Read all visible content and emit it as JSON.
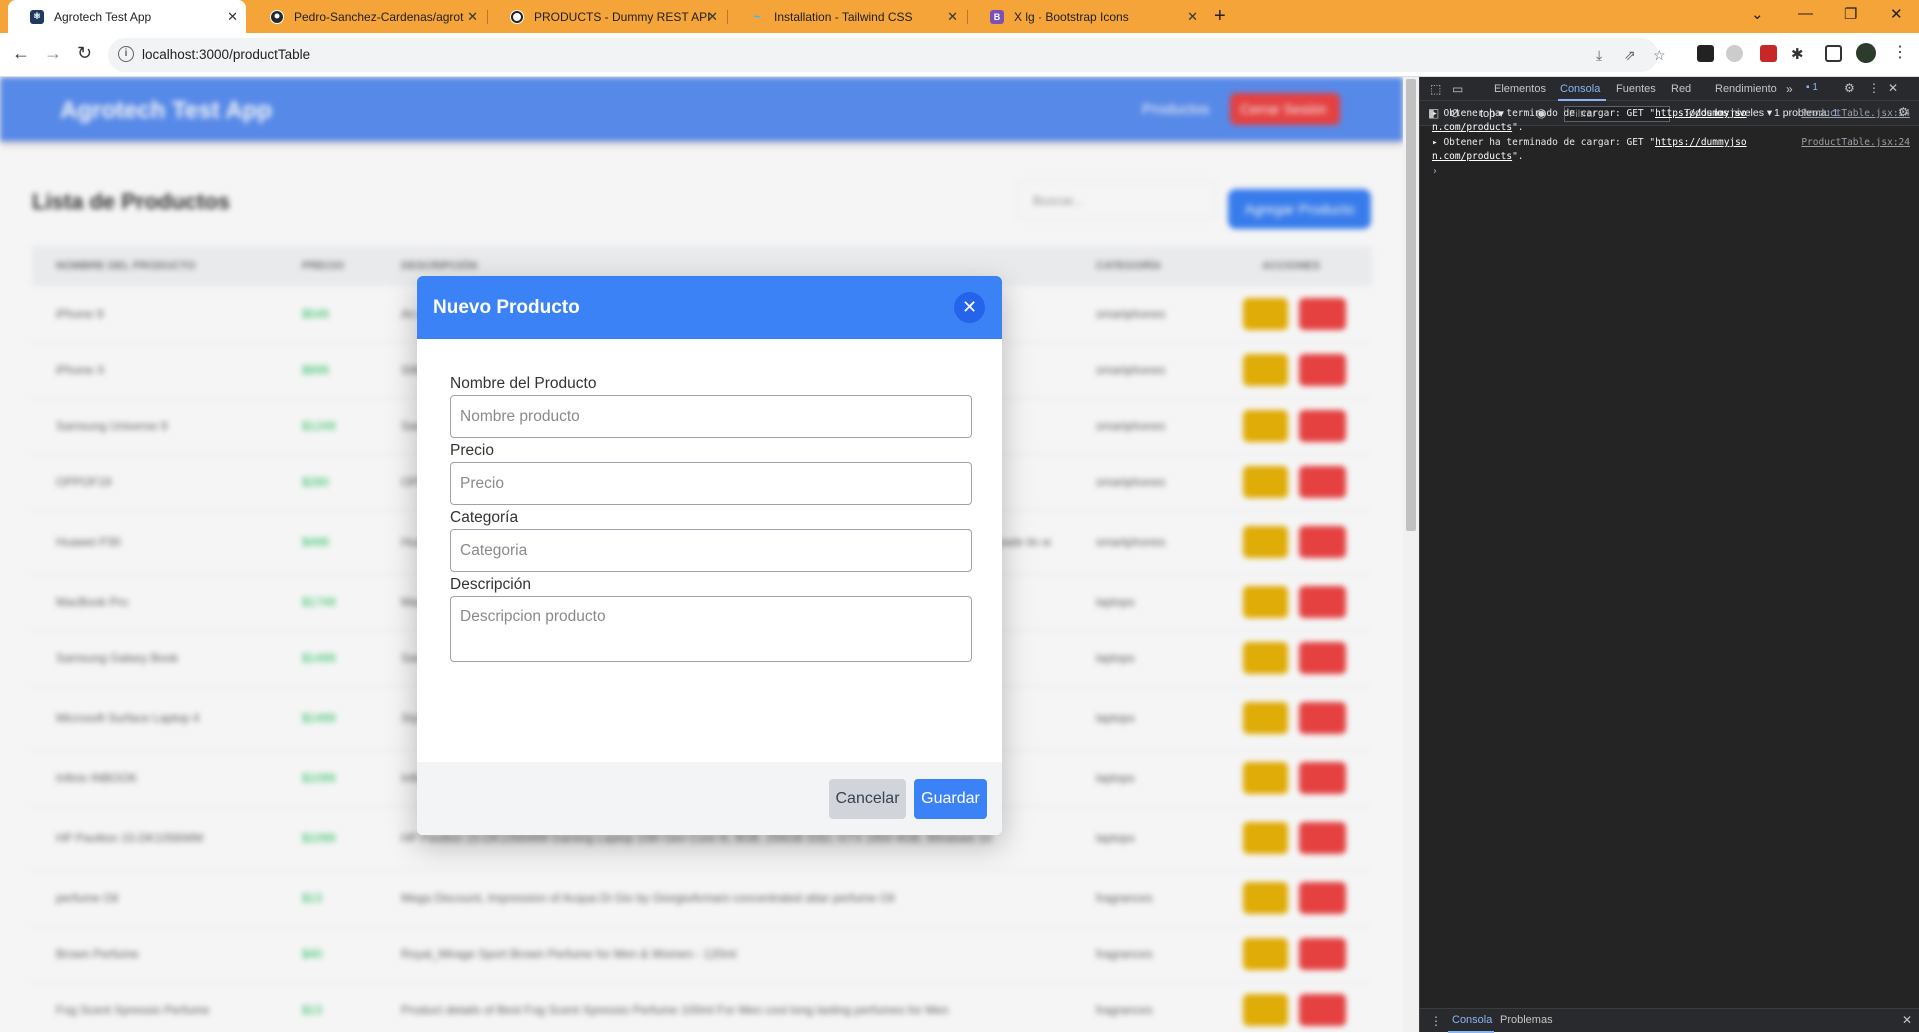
{
  "browser": {
    "tabs": [
      {
        "title": "Agrotech Test App",
        "favicon": "react-icon",
        "color": "#1e3a5f"
      },
      {
        "title": "Pedro-Sanchez-Cardenas/agrot",
        "favicon": "github-icon",
        "color": "#24292e"
      },
      {
        "title": "PRODUCTS - Dummy REST API c",
        "favicon": "dummyjson-icon",
        "color": "#222222"
      },
      {
        "title": "Installation - Tailwind CSS",
        "favicon": "tailwind-icon",
        "color": "#38bdf8"
      },
      {
        "title": "X lg · Bootstrap Icons",
        "favicon": "bootstrap-icon",
        "color": "#7952b3"
      }
    ],
    "url": "localhost:3000/productTable"
  },
  "app": {
    "brand": "Agrotech Test App",
    "nav_link": "Productos",
    "logout_label": "Cerrar Sesión",
    "page_title": "Lista de Productos",
    "search_placeholder": "Buscar...",
    "add_button": "Agregar Producto",
    "columns": [
      "NOMBRE DEL PRODUCTO",
      "PRECIO",
      "DESCRIPCIÓN",
      "CATEGORÍA",
      "ACCIONES"
    ],
    "rows": [
      {
        "name": "iPhone 9",
        "price": "$549",
        "desc": "An apple mobile which is nothing like apple",
        "cat": "smartphones"
      },
      {
        "name": "iPhone X",
        "price": "$899",
        "desc": "SIM-Free, Model A19211 6.5-inch Super Retina HD display with OLED technology A12 Bionic chip with ...",
        "cat": "smartphones"
      },
      {
        "name": "Samsung Universe 9",
        "price": "$1249",
        "desc": "Samsung's new variant which goes beyond Galaxy to the Universe",
        "cat": "smartphones"
      },
      {
        "name": "OPPOF19",
        "price": "$280",
        "desc": "OPPO F19 is officially announced on April 2021.",
        "cat": "smartphones"
      },
      {
        "name": "Huawei P30",
        "price": "$499",
        "desc": "Huawei's re-badged P30 Pro New Edition was officially unveiled yesterday in Germany and now the device has made its way to the UK.",
        "cat": "smartphones"
      },
      {
        "name": "MacBook Pro",
        "price": "$1749",
        "desc": "MacBook Pro 2021 with mini-LED display may launch between September, November",
        "cat": "laptops"
      },
      {
        "name": "Samsung Galaxy Book",
        "price": "$1499",
        "desc": "Samsung Galaxy Book S (2020) Laptop With Intel Lakefield Chip, 8GB of RAM Launched",
        "cat": "laptops"
      },
      {
        "name": "Microsoft Surface Laptop 4",
        "price": "$1499",
        "desc": "Style and speed. Stand out on HD video calls backed by Studio Mics. Capture ideas on the vibrant touchscreen.",
        "cat": "laptops"
      },
      {
        "name": "Infinix INBOOK",
        "price": "$1099",
        "desc": "Infinix Inbook X1 Ci3 10th 8GB 256GB 14 Win10 Grey – 1 Year Warranty",
        "cat": "laptops"
      },
      {
        "name": "HP Pavilion 15-DK1056WM",
        "price": "$1099",
        "desc": "HP Pavilion 15-DK1056WM Gaming Laptop 10th Gen Core i5, 8GB, 256GB SSD, GTX 1650 4GB, Windows 10",
        "cat": "laptops"
      },
      {
        "name": "perfume Oil",
        "price": "$13",
        "desc": "Mega Discount, Impression of Acqua Di Gio by GiorgioArmani concentrated attar perfume Oil",
        "cat": "fragrances"
      },
      {
        "name": "Brown Perfume",
        "price": "$40",
        "desc": "Royal_Mirage Sport Brown Perfume for Men & Women - 120ml",
        "cat": "fragrances"
      },
      {
        "name": "Fog Scent Xpressio Perfume",
        "price": "$13",
        "desc": "Product details of Best Fog Scent Xpressio Perfume 100ml For Men cool long lasting perfumes for Men",
        "cat": "fragrances"
      }
    ]
  },
  "modal": {
    "title": "Nuevo Producto",
    "fields": [
      {
        "label": "Nombre del Producto",
        "placeholder": "Nombre producto"
      },
      {
        "label": "Precio",
        "placeholder": "Precio"
      },
      {
        "label": "Categoría",
        "placeholder": "Categoria"
      },
      {
        "label": "Descripción",
        "placeholder": "Descripcion producto"
      }
    ],
    "cancel": "Cancelar",
    "save": "Guardar"
  },
  "devtools": {
    "tabs": [
      "Elementos",
      "Consola",
      "Fuentes",
      "Red",
      "Rendimiento"
    ],
    "issues_badge": "1",
    "context": "top",
    "filter_placeholder": "Filtrar",
    "levels": "Todos los niveles",
    "problems": "1 problema:",
    "problems_count": "1",
    "logs": [
      {
        "prefix": "Obtener ha terminado de cargar: GET \"",
        "link1": "https://dummyjso",
        "link2": "n.com/products",
        "suffix": "\".",
        "source": "ProductTable.jsx:24"
      },
      {
        "prefix": "Obtener ha terminado de cargar: GET \"",
        "link1": "https://dummyjso",
        "link2": "n.com/products",
        "suffix": "\".",
        "source": "ProductTable.jsx:24"
      }
    ],
    "bottom_tabs": [
      "Consola",
      "Problemas"
    ]
  }
}
